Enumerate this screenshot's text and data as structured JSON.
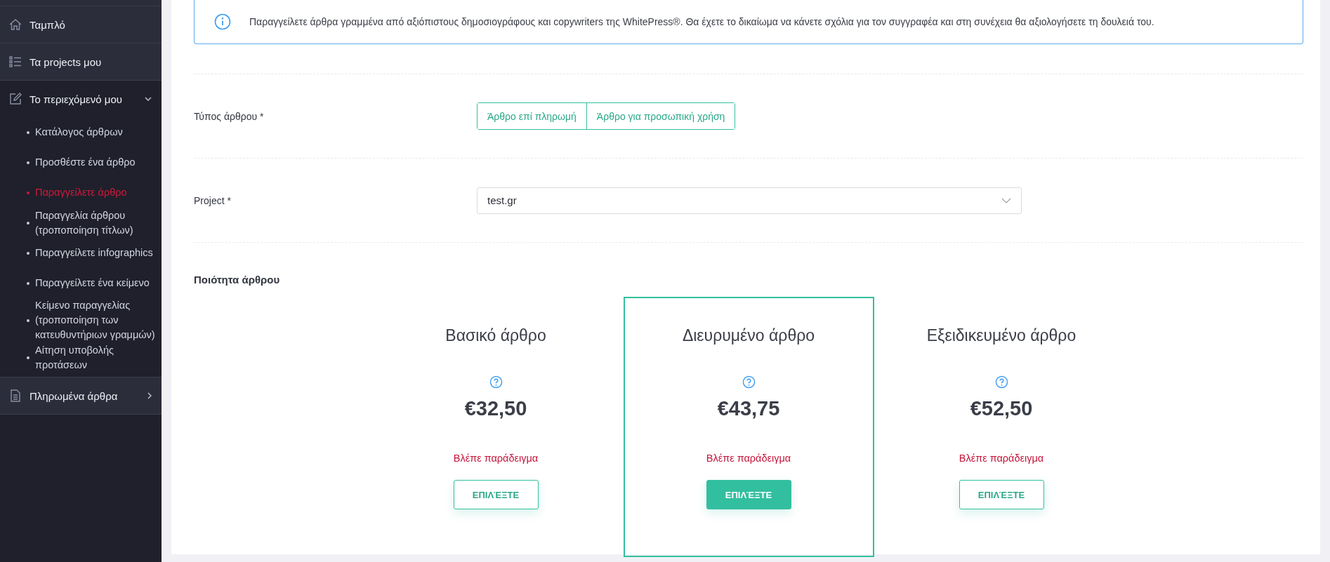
{
  "sidebar": {
    "items": [
      {
        "label": "Ταμπλό",
        "kind": "home",
        "expanded": false
      },
      {
        "label": "Τα projects μου",
        "kind": "list",
        "expanded": false
      },
      {
        "label": "Το περιεχόμενό μου",
        "kind": "edit",
        "expanded": true,
        "children": [
          {
            "label": "Κατάλογος άρθρων",
            "selected": false
          },
          {
            "label": "Προσθέστε ένα άρθρο",
            "selected": false
          },
          {
            "label": "Παραγγείλετε άρθρο",
            "selected": true
          },
          {
            "label": "Παραγγελία άρθρου (τροποποίηση τίτλων)",
            "selected": false
          },
          {
            "label": "Παραγγείλετε infographics",
            "selected": false
          },
          {
            "label": "Παραγγείλετε ένα κείμενο",
            "selected": false
          },
          {
            "label": "Κείμενο παραγγελίας (τροποποίηση των κατευθυντήριων γραμμών)",
            "selected": false
          },
          {
            "label": "Αίτηση υποβολής προτάσεων",
            "selected": false
          }
        ]
      },
      {
        "label": "Πληρωμένα άρθρα",
        "kind": "doc",
        "expanded": false
      }
    ]
  },
  "info": "Παραγγείλετε άρθρα γραμμένα από αξιόπιστους δημοσιογράφους και copywriters της WhitePress®. Θα έχετε το δικαίωμα να κάνετε σχόλια για τον συγγραφέα και στη συνέχεια θα αξιολογήσετε τη δουλειά του.",
  "article_type": {
    "label": "Τύπος άρθρου *",
    "options": [
      {
        "label": "Άρθρο επί πληρωμή",
        "selected": false
      },
      {
        "label": "Άρθρο για προσωπική χρήση",
        "selected": false
      }
    ]
  },
  "project": {
    "label": "Project *",
    "value": "test.gr"
  },
  "quality": {
    "title": "Ποιότητα άρθρου",
    "cards": [
      {
        "title": "Βασικό άρθρο",
        "price": "€32,50",
        "example": "Βλέπε παράδειγμα",
        "button": "ΕΠΙΛΈΞΤΕ",
        "selected": false
      },
      {
        "title": "Διευρυμένο άρθρο",
        "price": "€43,75",
        "example": "Βλέπε παράδειγμα",
        "button": "ΕΠΙΛΈΞΤΕ",
        "selected": true
      },
      {
        "title": "Εξειδικευμένο άρθρο",
        "price": "€52,50",
        "example": "Βλέπε παράδειγμα",
        "button": "ΕΠΙΛΈΞΤΕ",
        "selected": false
      }
    ]
  }
}
